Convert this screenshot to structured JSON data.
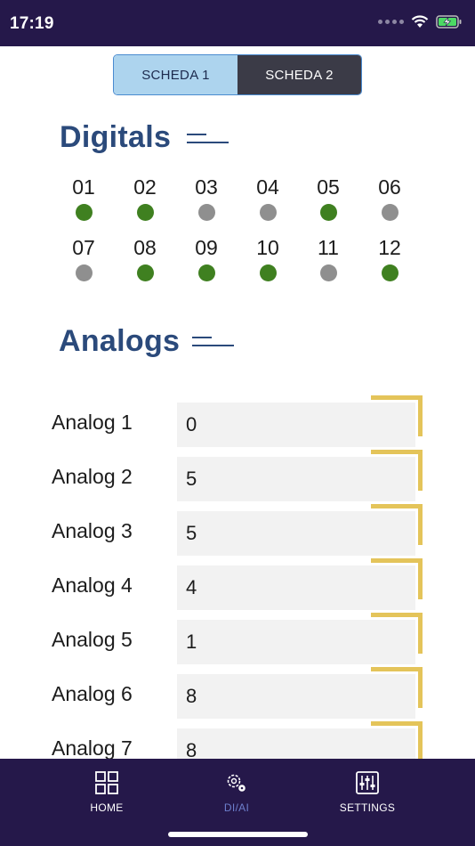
{
  "status_bar": {
    "time": "17:19"
  },
  "segmented_control": {
    "tabs": [
      {
        "label": "SCHEDA 1",
        "active": true
      },
      {
        "label": "SCHEDA 2",
        "active": false
      }
    ]
  },
  "digitals": {
    "title": "Digitals",
    "channels": [
      {
        "label": "01",
        "on": true
      },
      {
        "label": "02",
        "on": true
      },
      {
        "label": "03",
        "on": false
      },
      {
        "label": "04",
        "on": false
      },
      {
        "label": "05",
        "on": true
      },
      {
        "label": "06",
        "on": false
      },
      {
        "label": "07",
        "on": false
      },
      {
        "label": "08",
        "on": true
      },
      {
        "label": "09",
        "on": true
      },
      {
        "label": "10",
        "on": true
      },
      {
        "label": "11",
        "on": false
      },
      {
        "label": "12",
        "on": true
      }
    ]
  },
  "analogs": {
    "title": "Analogs",
    "rows": [
      {
        "label": "Analog 1",
        "value": "0"
      },
      {
        "label": "Analog 2",
        "value": "5"
      },
      {
        "label": "Analog 3",
        "value": "5"
      },
      {
        "label": "Analog 4",
        "value": "4"
      },
      {
        "label": "Analog 5",
        "value": "1"
      },
      {
        "label": "Analog 6",
        "value": "8"
      },
      {
        "label": "Analog 7",
        "value": "8"
      }
    ]
  },
  "tab_bar": {
    "items": [
      {
        "label": "HOME",
        "icon": "grid-icon",
        "active": false
      },
      {
        "label": "DI/AI",
        "icon": "gears-icon",
        "active": true
      },
      {
        "label": "SETTINGS",
        "icon": "sliders-icon",
        "active": false
      }
    ]
  },
  "colors": {
    "bar_background": "#25184a",
    "title": "#2b4a7b",
    "led_on": "#3f8020",
    "led_off": "#8f8f8f",
    "accent_yellow": "#e4c45a",
    "active_tab": "#6d7fcc"
  }
}
